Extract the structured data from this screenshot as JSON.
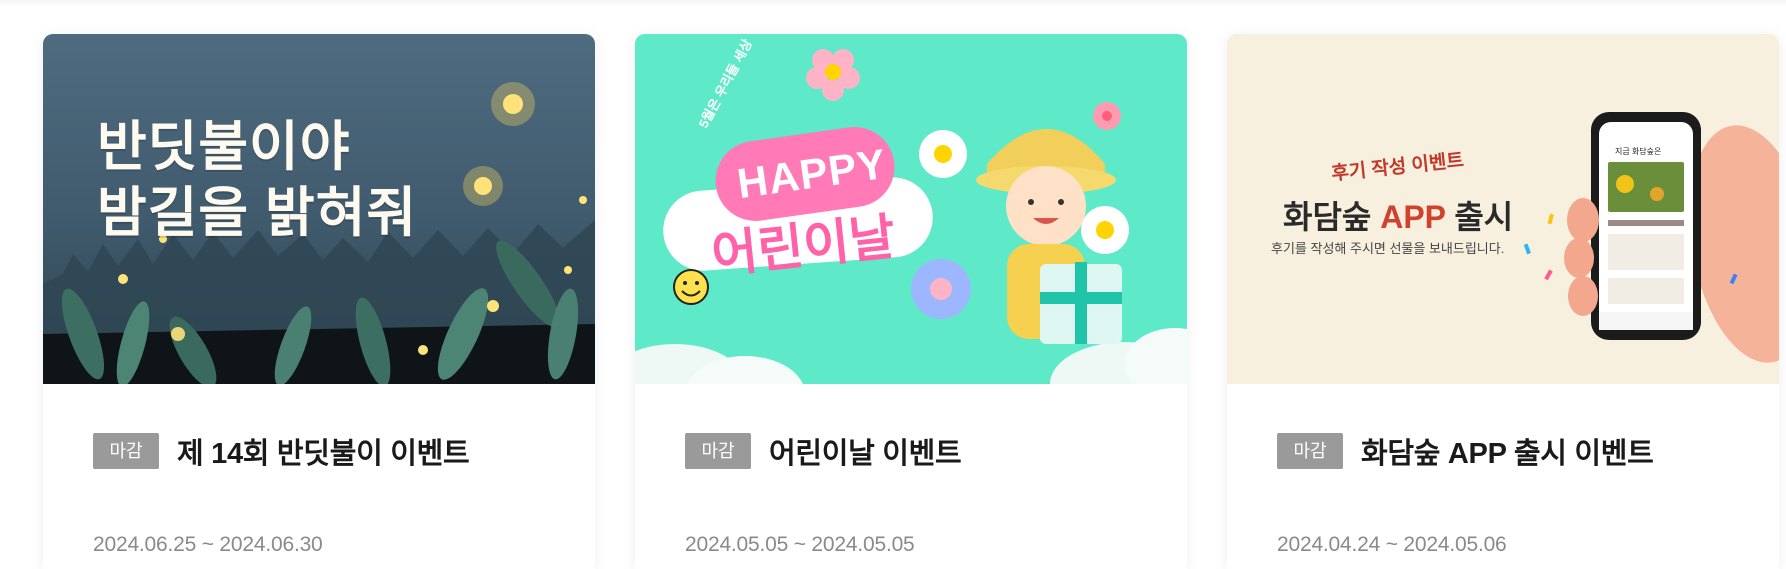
{
  "events": [
    {
      "banner": {
        "line1": "반딧불이야",
        "line2": "밤길을 밝혀줘"
      },
      "status": "마감",
      "title": "제 14회 반딧불이 이벤트",
      "date_range": "2024.06.25 ~ 2024.06.30"
    },
    {
      "banner": {
        "sub": "5월은 우리들 세상",
        "happy": "HAPPY",
        "headline": "어린이날"
      },
      "status": "마감",
      "title": "어린이날 이벤트",
      "date_range": "2024.05.05 ~ 2024.05.05"
    },
    {
      "banner": {
        "kicker": "후기 작성 이벤트",
        "title_a": "화담숲 ",
        "title_b": "APP",
        "title_c": " 출시",
        "desc": "후기를 작성해 주시면 선물을 보내드립니다.",
        "phone_header": "지금 화담숲은"
      },
      "status": "마감",
      "title": "화담숲 APP 출시 이벤트",
      "date_range": "2024.04.24 ~ 2024.05.06"
    }
  ],
  "colors": {
    "badge_bg": "#9a9a9a",
    "title": "#1a1a1a",
    "date": "#8a8a8a",
    "firefly_bg": "#4f6b80",
    "kids_bg": "#5ee9c8",
    "app_bg": "#f8f0df"
  }
}
